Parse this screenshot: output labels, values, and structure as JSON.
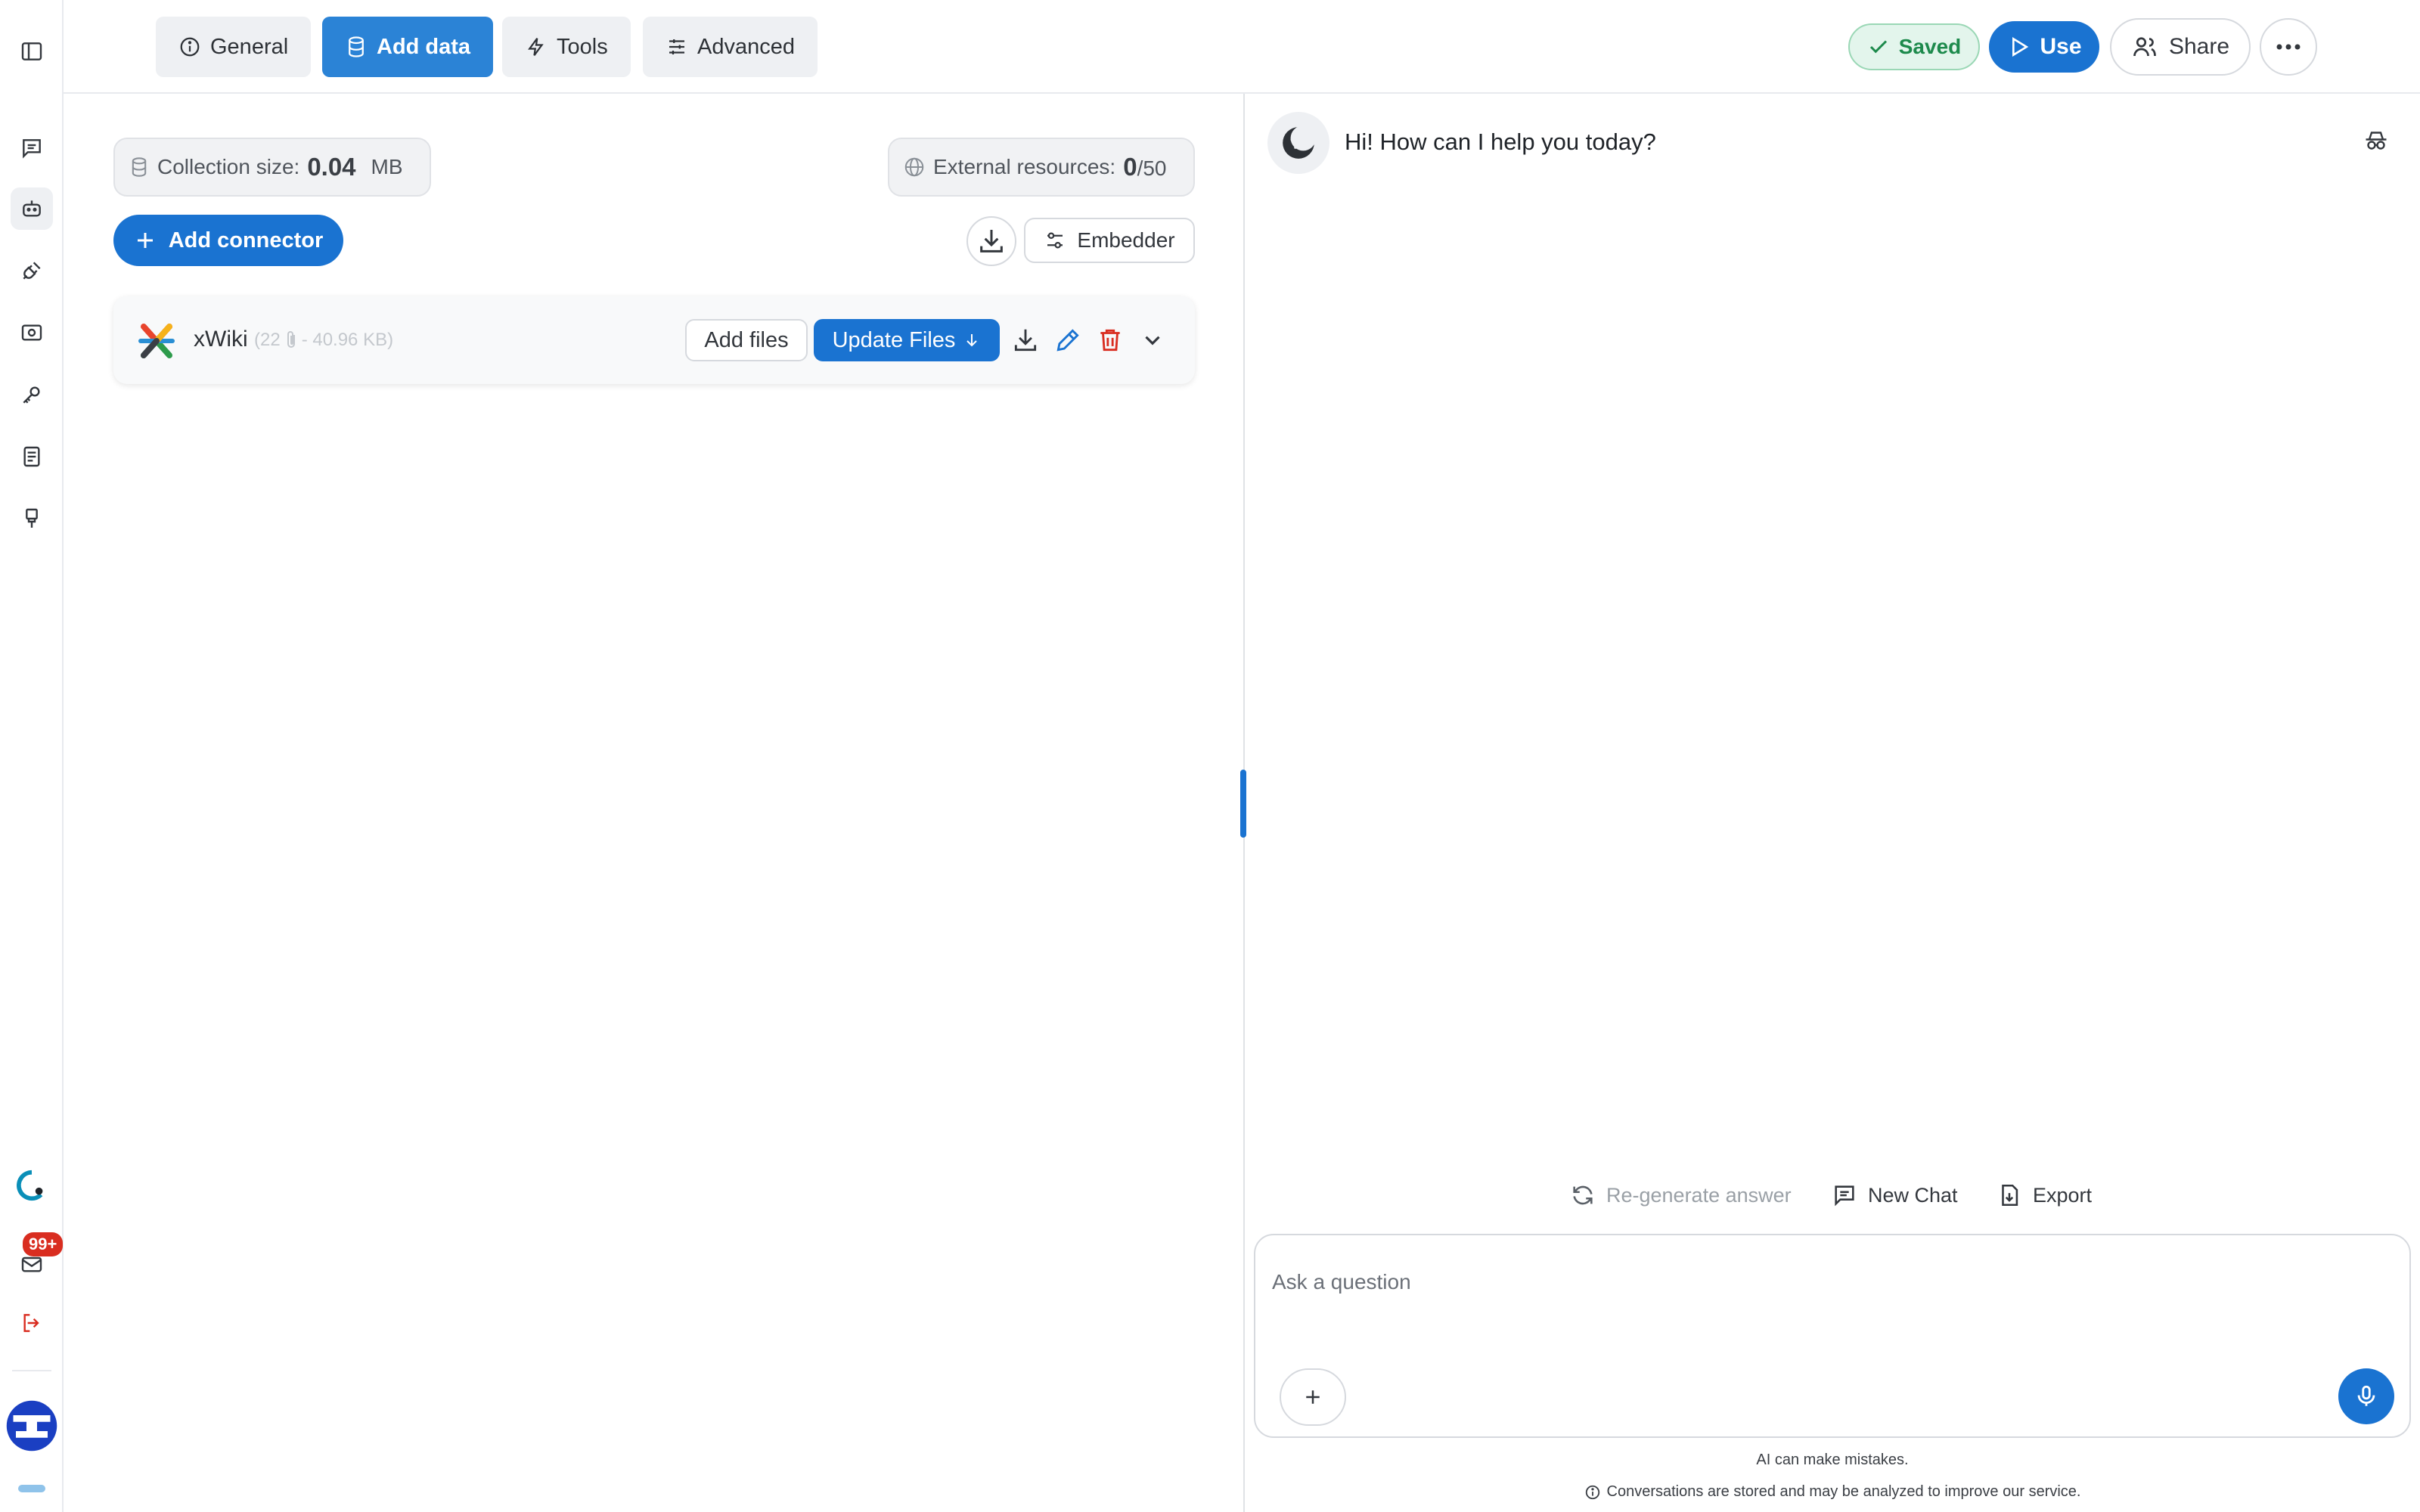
{
  "tabs": [
    {
      "label": "General",
      "icon": "info-icon",
      "active": false
    },
    {
      "label": "Add data",
      "icon": "database-icon",
      "active": true
    },
    {
      "label": "Tools",
      "icon": "bolt-icon",
      "active": false
    },
    {
      "label": "Advanced",
      "icon": "sliders-icon",
      "active": false
    }
  ],
  "header": {
    "saved_label": "Saved",
    "use_label": "Use",
    "share_label": "Share"
  },
  "rail": {
    "items": [
      "sidebar-toggle-icon",
      "chat-icon",
      "bot-icon",
      "plugin-icon",
      "scan-icon",
      "key-icon",
      "document-icon",
      "brush-icon"
    ],
    "notification_badge": "99+"
  },
  "collection": {
    "label": "Collection size:",
    "value": "0.04",
    "unit": "MB"
  },
  "external": {
    "label": "External resources:",
    "value": "0",
    "max": "/50"
  },
  "add_connector_label": "Add connector",
  "embedder_label": "Embedder",
  "connector": {
    "name": "xWiki",
    "meta_left": "(22",
    "meta_right": "- 40.96 KB)",
    "add_files_label": "Add files",
    "update_files_label": "Update Files"
  },
  "chat": {
    "greeting": "Hi! How can I help you today?",
    "regenerate_label": "Re-generate answer",
    "new_chat_label": "New Chat",
    "export_label": "Export",
    "input_placeholder": "Ask a question",
    "disclaimer": "AI can make mistakes.",
    "privacy_note": "Conversations are stored and may be analyzed to improve our service."
  },
  "colors": {
    "primary": "#1a73d1",
    "active_tab": "#2b83d6",
    "saved_green": "#1d8a4c",
    "danger": "#d92d20"
  }
}
